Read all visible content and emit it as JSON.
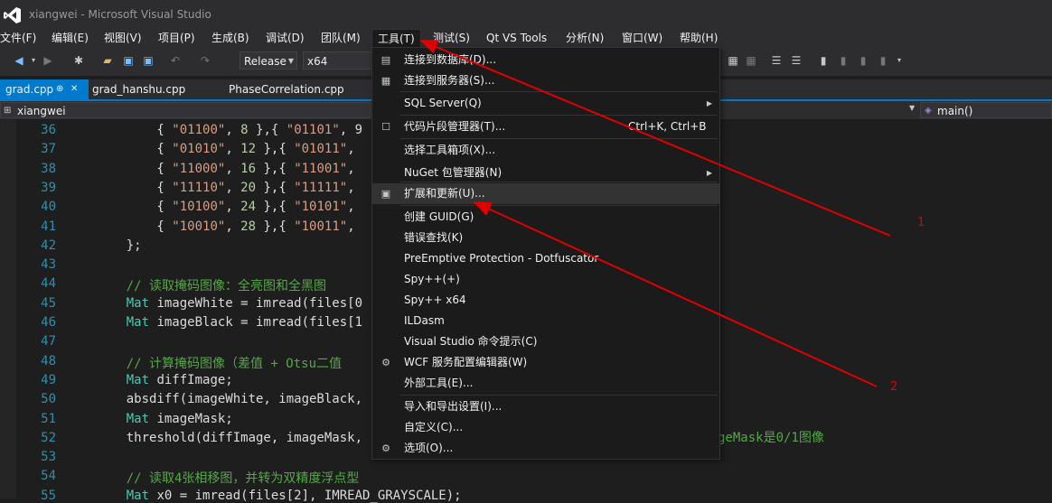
{
  "window": {
    "title": "xiangwei - Microsoft Visual Studio"
  },
  "menubar": [
    {
      "label": "文件(F)"
    },
    {
      "label": "编辑(E)"
    },
    {
      "label": "视图(V)"
    },
    {
      "label": "项目(P)"
    },
    {
      "label": "生成(B)"
    },
    {
      "label": "调试(D)"
    },
    {
      "label": "团队(M)"
    },
    {
      "label": "工具(T)"
    },
    {
      "label": "测试(S)"
    },
    {
      "label": "Qt VS Tools"
    },
    {
      "label": "分析(N)"
    },
    {
      "label": "窗口(W)"
    },
    {
      "label": "帮助(H)"
    }
  ],
  "toolbar": {
    "configuration": "Release",
    "platform": "x64"
  },
  "tabs": [
    {
      "label": "grad.cpp",
      "pin": "⊕",
      "close": "✕"
    },
    {
      "label": "grad_hanshu.cpp"
    },
    {
      "label": "PhaseCorrelation.cpp"
    }
  ],
  "navbar": {
    "scope": "xiangwei",
    "member": "main()"
  },
  "code_lines": [
    {
      "n": "36",
      "parts": [
        [
          "",
          "        { "
        ],
        [
          "s",
          "\"01100\""
        ],
        [
          "",
          ", "
        ],
        [
          "n",
          "8"
        ],
        [
          "",
          " },{ "
        ],
        [
          "s",
          "\"01101\""
        ],
        [
          "",
          ", 9"
        ]
      ]
    },
    {
      "n": "37",
      "parts": [
        [
          "",
          "        { "
        ],
        [
          "s",
          "\"01010\""
        ],
        [
          "",
          ", "
        ],
        [
          "n",
          "12"
        ],
        [
          "",
          " },{ "
        ],
        [
          "s",
          "\"01011\""
        ],
        [
          "",
          ","
        ]
      ]
    },
    {
      "n": "38",
      "parts": [
        [
          "",
          "        { "
        ],
        [
          "s",
          "\"11000\""
        ],
        [
          "",
          ", "
        ],
        [
          "n",
          "16"
        ],
        [
          "",
          " },{ "
        ],
        [
          "s",
          "\"11001\""
        ],
        [
          "",
          ","
        ]
      ]
    },
    {
      "n": "39",
      "parts": [
        [
          "",
          "        { "
        ],
        [
          "s",
          "\"11110\""
        ],
        [
          "",
          ", "
        ],
        [
          "n",
          "20"
        ],
        [
          "",
          " },{ "
        ],
        [
          "s",
          "\"11111\""
        ],
        [
          "",
          ","
        ]
      ]
    },
    {
      "n": "40",
      "parts": [
        [
          "",
          "        { "
        ],
        [
          "s",
          "\"10100\""
        ],
        [
          "",
          ", "
        ],
        [
          "n",
          "24"
        ],
        [
          "",
          " },{ "
        ],
        [
          "s",
          "\"10101\""
        ],
        [
          "",
          ","
        ]
      ]
    },
    {
      "n": "41",
      "parts": [
        [
          "",
          "        { "
        ],
        [
          "s",
          "\"10010\""
        ],
        [
          "",
          ", "
        ],
        [
          "n",
          "28"
        ],
        [
          "",
          " },{ "
        ],
        [
          "s",
          "\"10011\""
        ],
        [
          "",
          ","
        ]
      ]
    },
    {
      "n": "42",
      "parts": [
        [
          "",
          "    };"
        ]
      ]
    },
    {
      "n": "43",
      "parts": [
        [
          "",
          ""
        ]
      ]
    },
    {
      "n": "44",
      "parts": [
        [
          "c",
          "    // 读取掩码图像：全亮图和全黑图"
        ]
      ]
    },
    {
      "n": "45",
      "parts": [
        [
          "t",
          "    Mat"
        ],
        [
          "",
          " imageWhite = imread(files[0"
        ]
      ]
    },
    {
      "n": "46",
      "parts": [
        [
          "t",
          "    Mat"
        ],
        [
          "",
          " imageBlack = imread(files[1"
        ]
      ]
    },
    {
      "n": "47",
      "parts": [
        [
          "",
          ""
        ]
      ]
    },
    {
      "n": "48",
      "parts": [
        [
          "c",
          "    // 计算掩码图像（差值 + Otsu二值"
        ]
      ]
    },
    {
      "n": "49",
      "parts": [
        [
          "t",
          "    Mat"
        ],
        [
          "",
          " diffImage;"
        ]
      ]
    },
    {
      "n": "50",
      "parts": [
        [
          "",
          "    absdiff(imageWhite, imageBlack,"
        ]
      ]
    },
    {
      "n": "51",
      "parts": [
        [
          "t",
          "    Mat"
        ],
        [
          "",
          " imageMask;"
        ]
      ]
    },
    {
      "n": "52",
      "parts": [
        [
          "",
          "    threshold(diffImage, imageMask,"
        ]
      ]
    },
    {
      "n": "53",
      "parts": [
        [
          "",
          ""
        ]
      ]
    },
    {
      "n": "54",
      "parts": [
        [
          "c",
          "    // 读取4张相移图，并转为双精度浮点型"
        ]
      ]
    },
    {
      "n": "55",
      "parts": [
        [
          "t",
          "    Mat"
        ],
        [
          "",
          " x0 = imread(files[2], IMREAD_GRAYSCALE);"
        ]
      ]
    }
  ],
  "code_tail_52": "geMask是0/1图像",
  "tools_menu": [
    {
      "label": "连接到数据库(D)...",
      "icon": "db-connect-icon",
      "glyph": "▤"
    },
    {
      "label": "连接到服务器(S)...",
      "icon": "server-connect-icon",
      "glyph": "▦"
    },
    {
      "label": "SQL Server(Q)",
      "submenu": "▶"
    },
    {
      "label": "代码片段管理器(T)...",
      "icon": "snippet-icon",
      "glyph": "☐",
      "shortcut": "Ctrl+K, Ctrl+B"
    },
    {
      "label": "选择工具箱项(X)..."
    },
    {
      "label": "NuGet 包管理器(N)",
      "submenu": "▶"
    },
    {
      "label": "扩展和更新(U)...",
      "icon": "extensions-icon",
      "glyph": "▣"
    },
    {
      "label": "创建 GUID(G)"
    },
    {
      "label": "错误查找(K)"
    },
    {
      "label": "PreEmptive Protection - Dotfuscator"
    },
    {
      "label": "Spy++(+)"
    },
    {
      "label": "Spy++ x64"
    },
    {
      "label": "ILDasm"
    },
    {
      "label": "Visual Studio 命令提示(C)"
    },
    {
      "label": "WCF 服务配置编辑器(W)",
      "icon": "wcf-icon",
      "glyph": "⚙"
    },
    {
      "label": "外部工具(E)..."
    },
    {
      "label": "导入和导出设置(I)..."
    },
    {
      "label": "自定义(C)..."
    },
    {
      "label": "选项(O)...",
      "icon": "options-gear-icon",
      "glyph": "⚙"
    }
  ],
  "annotations": {
    "label1": "1",
    "label2": "2",
    "color": "#e00000"
  },
  "colors": {
    "accent": "#007acc",
    "chrome": "#2d2d30",
    "editor_bg": "#1e1e1e"
  }
}
